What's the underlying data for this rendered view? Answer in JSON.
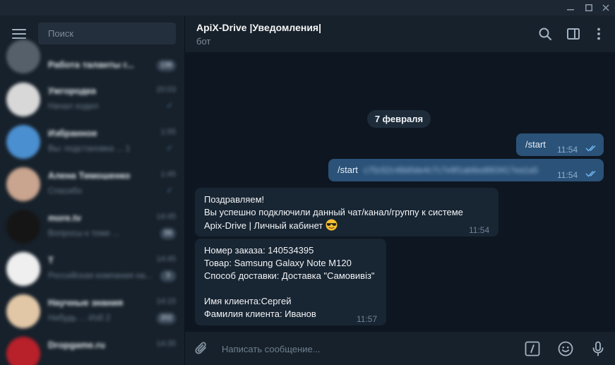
{
  "sidebar": {
    "search_placeholder": "Поиск",
    "chats": [
      {
        "name": "Работа таланты г...",
        "preview": "",
        "time": "",
        "badge": "136",
        "avatar_color": "#56606b"
      },
      {
        "name": "Ужгородка",
        "preview": "Начал ходил",
        "time": "20:03",
        "badge": "",
        "avatar_color": "#d8d8d8"
      },
      {
        "name": "Избранное",
        "preview": "Вы: подстановка ... 1",
        "time": "1:55",
        "badge": "",
        "avatar_color": "#4a8fd0"
      },
      {
        "name": "Алена Тимошенко",
        "preview": "Спасибо",
        "time": "1:45",
        "badge": "",
        "avatar_color": "#c9a48e"
      },
      {
        "name": "more.tv",
        "preview": "Вопросы к теме ...",
        "time": "14:45",
        "badge": "59",
        "avatar_color": "#151515"
      },
      {
        "name": "T",
        "preview": "Российская компания на...",
        "time": "14:45",
        "badge": "3",
        "avatar_color": "#efefef"
      },
      {
        "name": "Научные знания",
        "preview": "Нибудь ... Изб 2",
        "time": "14:15",
        "badge": "202",
        "avatar_color": "#e2c7a6"
      },
      {
        "name": "Dropgame.ru",
        "preview": "",
        "time": "14:35",
        "badge": "",
        "avatar_color": "#b8202a"
      }
    ]
  },
  "header": {
    "title": "ApiX-Drive |Уведомления|",
    "subtitle": "бот"
  },
  "messages": {
    "date": "7 февраля",
    "out1": {
      "text": "/start",
      "time": "11:54"
    },
    "out2": {
      "text": "/start",
      "token": "c75c52c48d0de4c7c7e9f1ab6ed663417ea1a5",
      "time": "11:54"
    },
    "in1": {
      "line1": "Поздравляем!",
      "line2": "Вы успешно подключили данный чат/канал/группу к системе",
      "line3": "Apix-Drive | Личный кабинет",
      "time": "11:54"
    },
    "in2": {
      "line1": "Номер заказа: 140534395",
      "line2": "Товар: Samsung Galaxy Note M120",
      "line3": "Способ доставки: Доставка \"Самовивіз\"",
      "line4": "Имя клиента:Сергей",
      "line5": "Фамилия клиента: Иванов",
      "time": "11:57"
    }
  },
  "composer": {
    "placeholder": "Написать сообщение..."
  },
  "colors": {
    "background": "#0e1621",
    "panel": "#17212b",
    "outgoing_bubble": "#2b5278",
    "incoming_bubble": "#182533"
  }
}
